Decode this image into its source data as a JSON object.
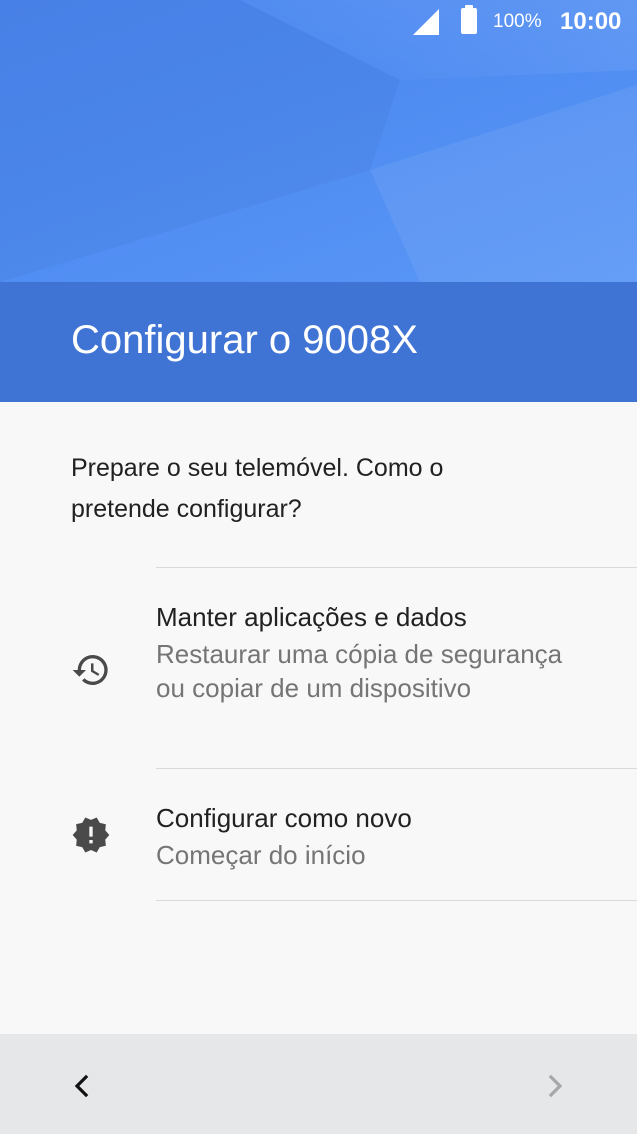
{
  "status_bar": {
    "signal_icon": "signal-icon",
    "battery_icon": "battery-full-icon",
    "battery_percent": "100%",
    "time": "10:00"
  },
  "header": {
    "title": "Configurar o 9008X"
  },
  "content": {
    "prompt": "Prepare o seu telemóvel. Como o pretende configurar?",
    "options": [
      {
        "icon": "history-restore-icon",
        "title": "Manter aplicações e dados",
        "description": "Restaurar uma cópia de segurança ou copiar de um dispositivo"
      },
      {
        "icon": "new-badge-icon",
        "title": "Configurar como novo",
        "description": "Começar do início"
      }
    ]
  },
  "nav": {
    "back_icon": "chevron-left-icon",
    "next_icon": "chevron-right-icon"
  },
  "colors": {
    "hero_blue": "#4f8cf2",
    "title_bar_blue": "#3f73d4",
    "nav_bar": "#e6e7e9",
    "text_primary": "#212121",
    "text_secondary": "#757575"
  }
}
